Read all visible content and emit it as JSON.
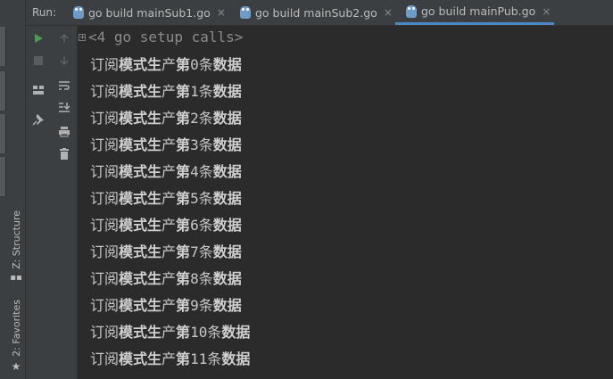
{
  "run_panel": {
    "run_label": "Run:",
    "tabs": [
      {
        "label": "go build mainSub1.go",
        "active": false
      },
      {
        "label": "go build mainSub2.go",
        "active": false
      },
      {
        "label": "go build mainPub.go",
        "active": true
      }
    ],
    "close_glyph": "×"
  },
  "side_tabs": {
    "structure": "Z: Structure",
    "favorites": "2: Favorites"
  },
  "console": {
    "setup_calls": "<4 go setup calls>",
    "lines": [
      {
        "p1": "订阅",
        "p2": "模式生",
        "p3": "产",
        "p4": "第",
        "n": "0",
        "p5": "条",
        "p6": "数据"
      },
      {
        "p1": "订阅",
        "p2": "模式生",
        "p3": "产",
        "p4": "第",
        "n": "1",
        "p5": "条",
        "p6": "数据"
      },
      {
        "p1": "订阅",
        "p2": "模式生",
        "p3": "产",
        "p4": "第",
        "n": "2",
        "p5": "条",
        "p6": "数据"
      },
      {
        "p1": "订阅",
        "p2": "模式生",
        "p3": "产",
        "p4": "第",
        "n": "3",
        "p5": "条",
        "p6": "数据"
      },
      {
        "p1": "订阅",
        "p2": "模式生",
        "p3": "产",
        "p4": "第",
        "n": "4",
        "p5": "条",
        "p6": "数据"
      },
      {
        "p1": "订阅",
        "p2": "模式生",
        "p3": "产",
        "p4": "第",
        "n": "5",
        "p5": "条",
        "p6": "数据"
      },
      {
        "p1": "订阅",
        "p2": "模式生",
        "p3": "产",
        "p4": "第",
        "n": "6",
        "p5": "条",
        "p6": "数据"
      },
      {
        "p1": "订阅",
        "p2": "模式生",
        "p3": "产",
        "p4": "第",
        "n": "7",
        "p5": "条",
        "p6": "数据"
      },
      {
        "p1": "订阅",
        "p2": "模式生",
        "p3": "产",
        "p4": "第",
        "n": "8",
        "p5": "条",
        "p6": "数据"
      },
      {
        "p1": "订阅",
        "p2": "模式生",
        "p3": "产",
        "p4": "第",
        "n": "9",
        "p5": "条",
        "p6": "数据"
      },
      {
        "p1": "订阅",
        "p2": "模式生",
        "p3": "产",
        "p4": "第",
        "n": "10",
        "p5": "条",
        "p6": "数据"
      },
      {
        "p1": "订阅",
        "p2": "模式生",
        "p3": "产",
        "p4": "第",
        "n": "11",
        "p5": "条",
        "p6": "数据"
      }
    ]
  },
  "toolbar": {
    "run_icon": "rerun-icon",
    "stop_icon": "stop-icon",
    "layout_icon": "restore-layout-icon",
    "pin_icon": "pin-icon",
    "up_icon": "up-arrow-icon",
    "down_icon": "down-arrow-icon",
    "wrap_icon": "soft-wrap-icon",
    "scroll_icon": "scroll-to-end-icon",
    "print_icon": "print-icon",
    "trash_icon": "clear-all-icon"
  },
  "colors": {
    "accent": "#4a88c7",
    "run_green": "#499c54",
    "background": "#2b2b2b",
    "panel": "#3c3f41"
  }
}
